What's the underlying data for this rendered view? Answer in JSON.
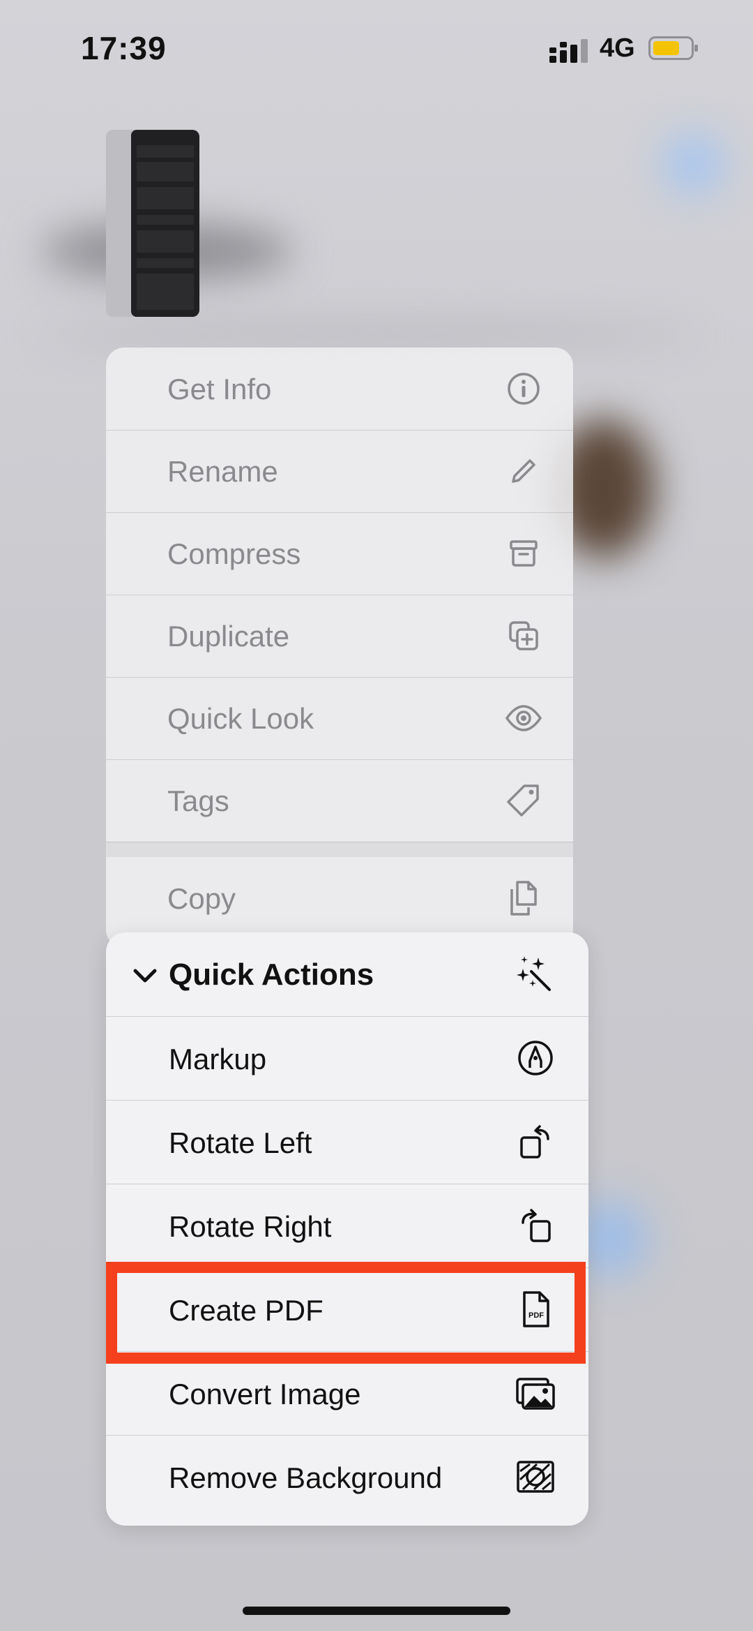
{
  "status_bar": {
    "time": "17:39",
    "network": "4G",
    "battery_color": "#f5c400"
  },
  "context_menu": {
    "items": [
      {
        "label": "Get Info",
        "icon": "info-circle-icon"
      },
      {
        "label": "Rename",
        "icon": "pencil-icon"
      },
      {
        "label": "Compress",
        "icon": "archive-box-icon"
      },
      {
        "label": "Duplicate",
        "icon": "duplicate-plus-icon"
      },
      {
        "label": "Quick Look",
        "icon": "eye-icon"
      },
      {
        "label": "Tags",
        "icon": "tag-icon"
      },
      {
        "label": "Copy",
        "icon": "documents-icon"
      }
    ]
  },
  "quick_actions": {
    "header": "Quick Actions",
    "header_icon": "sparkles-wand-icon",
    "items": [
      {
        "label": "Markup",
        "icon": "markup-pen-icon"
      },
      {
        "label": "Rotate Left",
        "icon": "rotate-left-icon"
      },
      {
        "label": "Rotate Right",
        "icon": "rotate-right-icon"
      },
      {
        "label": "Create PDF",
        "icon": "pdf-document-icon",
        "highlighted": true
      },
      {
        "label": "Convert Image",
        "icon": "photos-icon"
      },
      {
        "label": "Remove Background",
        "icon": "remove-background-icon"
      }
    ]
  },
  "highlight_color": "#f4401c"
}
